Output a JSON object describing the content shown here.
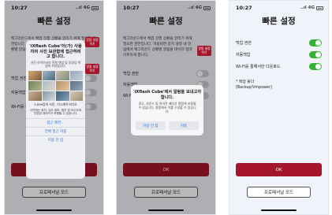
{
  "status": {
    "time": "10:27",
    "signal": "..ıl",
    "network": "4G"
  },
  "screen_title": "빠른 설정",
  "description": "백그라운드에서 백업 진행 상황을 알리기 위해 필요한 권한입니다. 허용되면 장치 설정 내 알림에서 백그라운드 상황별 알림을 데이터 업데이트하게 합니다.",
  "settings": {
    "backup": "백업 권한",
    "auto_backup": "자동백업",
    "wifi_download": "Wi-Fi를 통해서만 다운로드"
  },
  "folder": {
    "label": "* 백업 폴더",
    "path": "[Backup/Vmpower]"
  },
  "buttons": {
    "ok": "OK",
    "pro_mode": "프로페셔널 모드",
    "side_action": "알림 설정하기"
  },
  "photo_dialog": {
    "title": "'iXflash Cube'이(가) 사용자의 사진 보관함에 접근하려고 합니다.",
    "subtitle": "사진 라이브러리 전체 백업 및 동영상 백업에 사용됩니다.",
    "count": "5,899장의 사진, 732개의 비디오",
    "note": "사진에는 위치, 심도 정보, 캡션 및 오디오와 관련된 데이터가 포함될 수 있습니다.",
    "actions": [
      "접근 제한...",
      "전체 접근 허용",
      "허용 안 함"
    ]
  },
  "notify_dialog": {
    "title": "'iXflash Cube'에서 알림을 보내고자 합니다.",
    "message": "경고, 사운드 및 아이콘 배지가 알림에 포함될 수 있습니다. 설정에서 이를 구성할 수 있습니다.",
    "deny": "허용 안 함",
    "allow": "허용"
  },
  "colors": {
    "accent": "#a5162a",
    "toggle_on": "#34b233",
    "link": "#2d6fd6"
  }
}
